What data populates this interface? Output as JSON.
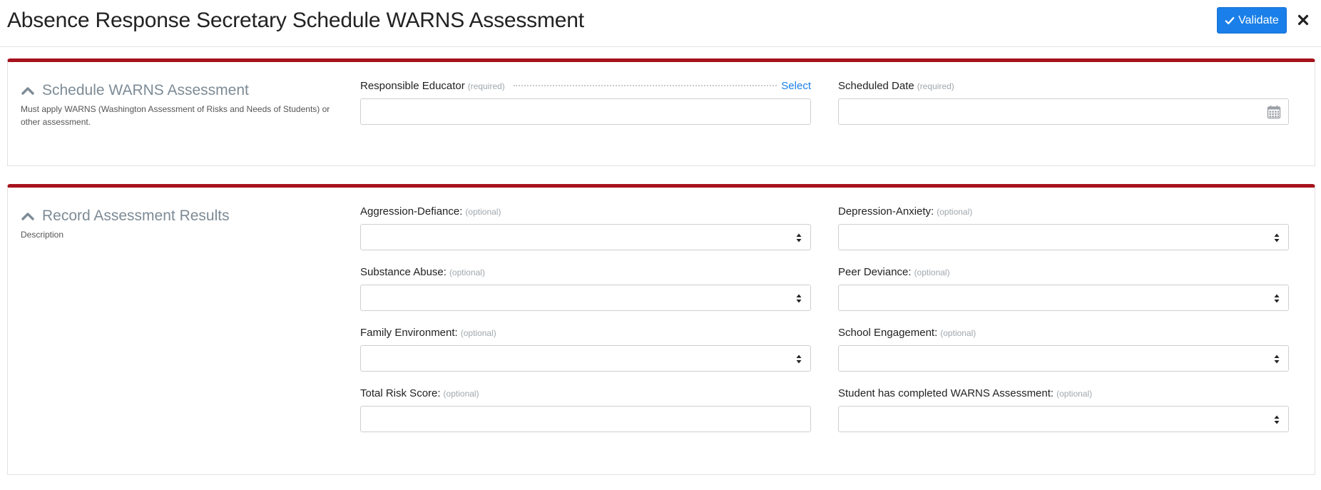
{
  "header": {
    "title": "Absence Response Secretary Schedule WARNS Assessment",
    "validate_label": "Validate"
  },
  "schedule": {
    "title": "Schedule WARNS Assessment",
    "description": "Must apply WARNS (Washington Assessment of Risks and Needs of Students) or other assessment.",
    "responsible_educator": {
      "label": "Responsible Educator",
      "tag": "(required)",
      "select_label": "Select",
      "value": ""
    },
    "scheduled_date": {
      "label": "Scheduled Date",
      "tag": "(required)",
      "value": ""
    }
  },
  "results": {
    "title": "Record Assessment Results",
    "description": "Description",
    "fields": [
      {
        "label": "Aggression-Defiance:",
        "tag": "(optional)",
        "value": ""
      },
      {
        "label": "Depression-Anxiety:",
        "tag": "(optional)",
        "value": ""
      },
      {
        "label": "Substance Abuse:",
        "tag": "(optional)",
        "value": ""
      },
      {
        "label": "Peer Deviance:",
        "tag": "(optional)",
        "value": ""
      },
      {
        "label": "Family Environment:",
        "tag": "(optional)",
        "value": ""
      },
      {
        "label": "School Engagement:",
        "tag": "(optional)",
        "value": ""
      },
      {
        "label": "Total Risk Score:",
        "tag": "(optional)",
        "value": ""
      },
      {
        "label": "Student has completed WARNS Assessment:",
        "tag": "(optional)",
        "value": ""
      }
    ]
  },
  "colors": {
    "accent": "#1a7fe8",
    "panel_border": "#a6121c",
    "section_title": "#7d8b96"
  },
  "icons": {
    "validate": "check-icon",
    "close": "close-icon",
    "collapse": "chevron-up-icon",
    "date": "calendar-icon",
    "select": "sort-arrows-icon"
  }
}
